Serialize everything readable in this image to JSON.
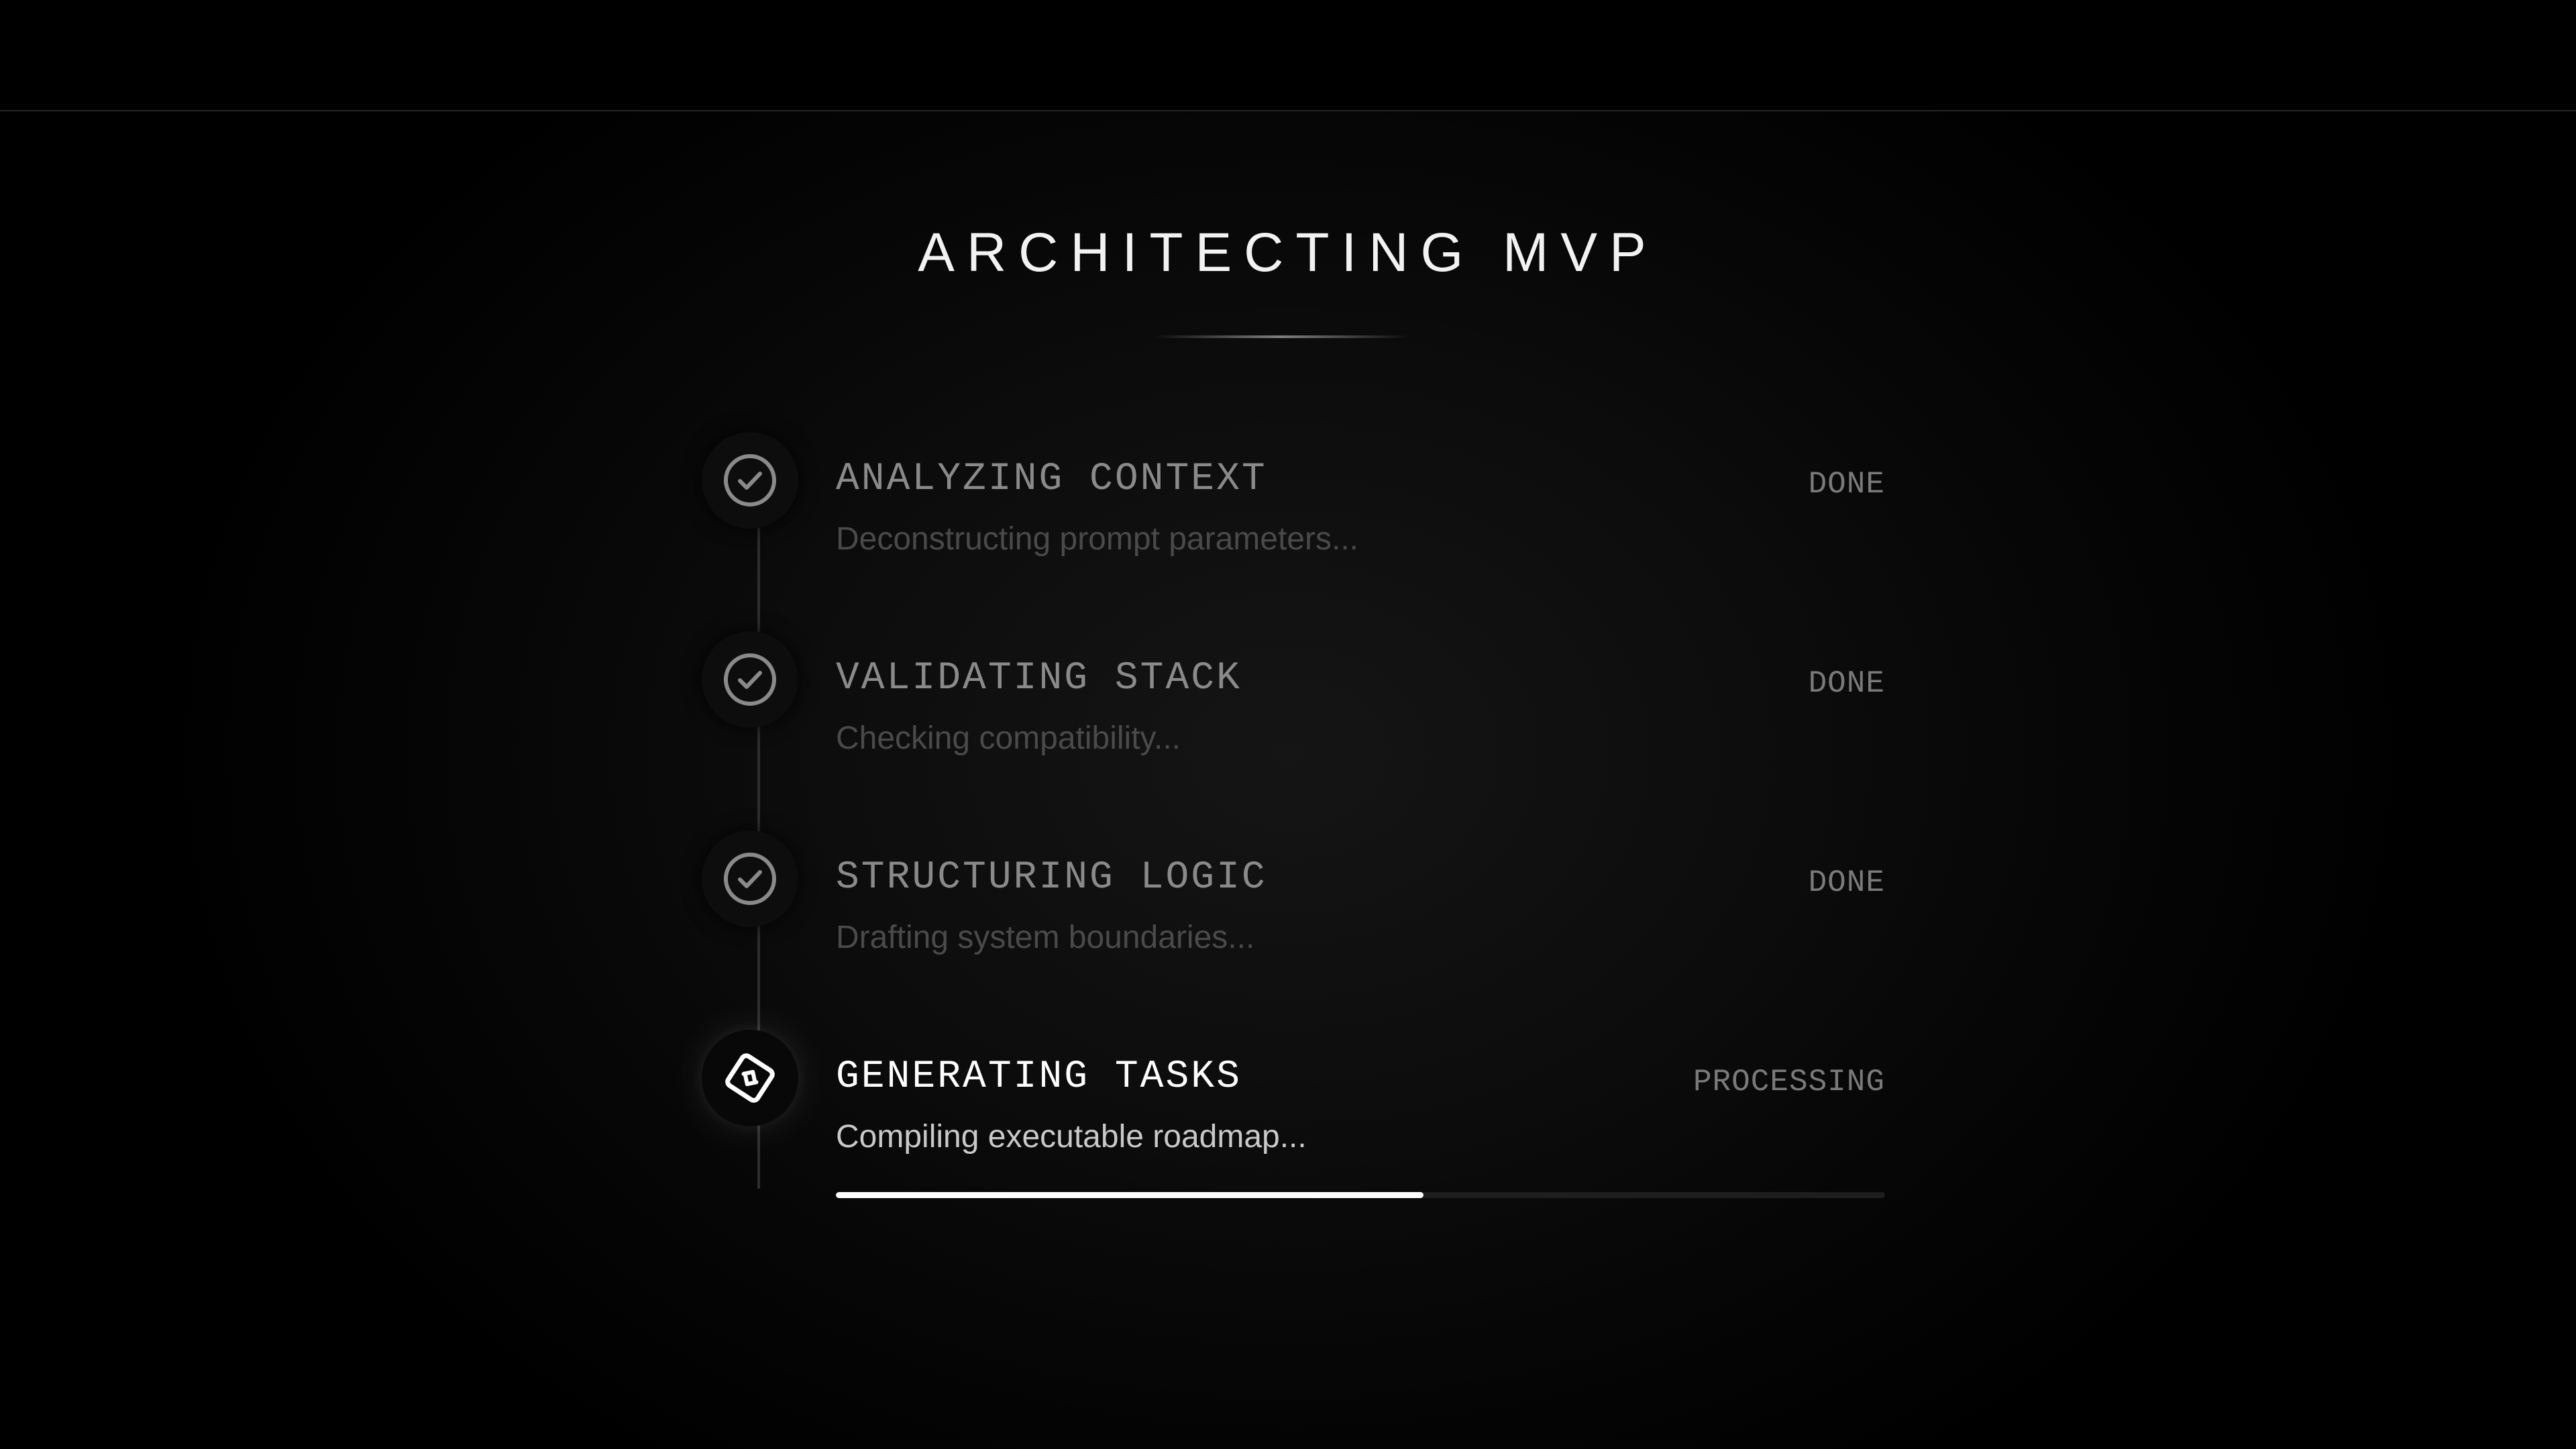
{
  "title": "ARCHITECTING MVP",
  "steps": [
    {
      "name": "ANALYZING CONTEXT",
      "description": "Deconstructing prompt parameters...",
      "status": "DONE",
      "icon": "check-circle-icon"
    },
    {
      "name": "VALIDATING STACK",
      "description": "Checking compatibility...",
      "status": "DONE",
      "icon": "check-circle-icon"
    },
    {
      "name": "STRUCTURING LOGIC",
      "description": "Drafting system boundaries...",
      "status": "DONE",
      "icon": "check-circle-icon"
    },
    {
      "name": "GENERATING TASKS",
      "description": "Compiling executable roadmap...",
      "status": "PROCESSING",
      "icon": "processing-diamond-icon"
    }
  ],
  "progress": {
    "value": 0.56
  },
  "colors": {
    "background": "#000000",
    "accent": "#ffffff",
    "muted_text": "#8a8a8a",
    "dim_text": "#4a4a4a"
  }
}
